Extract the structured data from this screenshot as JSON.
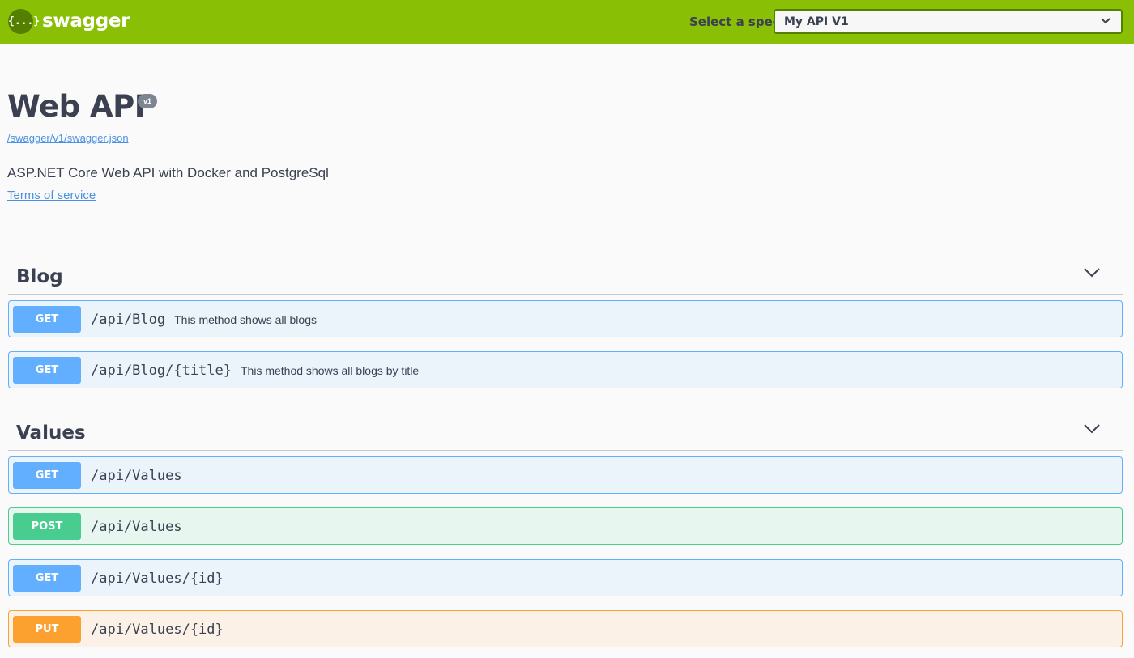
{
  "topbar": {
    "logo_icon": "{...}",
    "logo_text": "swagger",
    "spec_label": "Select a spec",
    "spec_selected": "My API V1",
    "brand_color": "#89bf04"
  },
  "info": {
    "title": "Web API",
    "version": "v1",
    "spec_url": "/swagger/v1/swagger.json",
    "description": "ASP.NET Core Web API with Docker and PostgreSql",
    "terms_of_service": "Terms of service"
  },
  "tags": [
    {
      "name": "Blog",
      "operations": [
        {
          "method": "GET",
          "path": "/api/Blog",
          "summary": "This method shows all blogs"
        },
        {
          "method": "GET",
          "path": "/api/Blog/{title}",
          "summary": "This method shows all blogs by title"
        }
      ]
    },
    {
      "name": "Values",
      "operations": [
        {
          "method": "GET",
          "path": "/api/Values",
          "summary": ""
        },
        {
          "method": "POST",
          "path": "/api/Values",
          "summary": ""
        },
        {
          "method": "GET",
          "path": "/api/Values/{id}",
          "summary": ""
        },
        {
          "method": "PUT",
          "path": "/api/Values/{id}",
          "summary": ""
        }
      ]
    }
  ],
  "colors": {
    "get": "#61affe",
    "post": "#49cc90",
    "put": "#fca130",
    "link": "#4990e2",
    "text": "#3b4151"
  },
  "icons": {
    "logo": "swagger-logo-icon",
    "select": "chevron-down-icon",
    "tag_toggle": "chevron-down-icon"
  }
}
